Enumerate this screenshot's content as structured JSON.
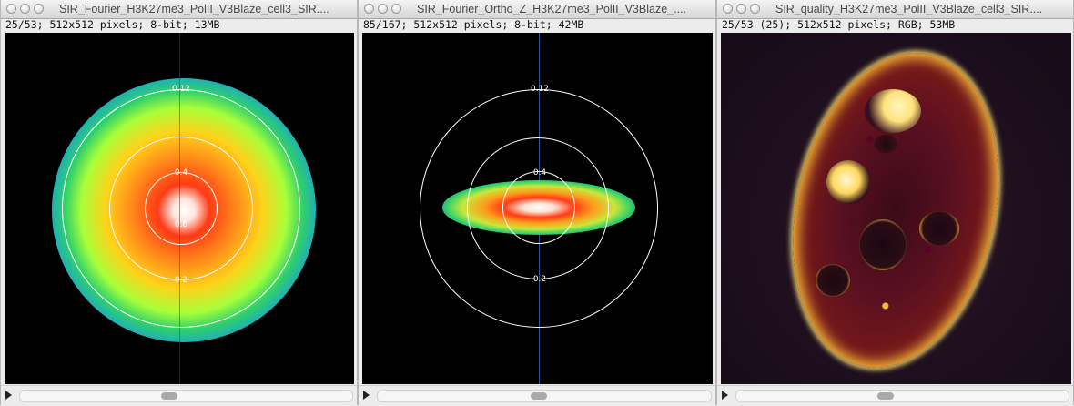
{
  "windows": [
    {
      "title": "SIR_Fourier_H3K27me3_PolII_V3Blaze_cell3_SIR....",
      "info": "25/53; 512x512 pixels; 8-bit; 13MB",
      "ring_labels": [
        "0.12",
        "0.4",
        "0.8",
        "0.2"
      ],
      "scroll_position_fraction": 0.47
    },
    {
      "title": "SIR_Fourier_Ortho_Z_H3K27me3_PolII_V3Blaze_....",
      "info": "85/167; 512x512 pixels; 8-bit; 42MB",
      "ring_labels": [
        "0.12",
        "0.4",
        "0.2"
      ],
      "scroll_position_fraction": 0.5
    },
    {
      "title": "SIR_quality_H3K27me3_PolII_V3Blaze_cell3_SIR....",
      "info": "25/53 (25); 512x512 pixels; RGB; 53MB",
      "scroll_position_fraction": 0.47
    }
  ],
  "colors": {
    "spectrum_center": "#ffffff",
    "spectrum_mid": "#ff5a1f",
    "spectrum_outer": "#2a3fd0",
    "nucleus_edge": "#fff3a8"
  }
}
